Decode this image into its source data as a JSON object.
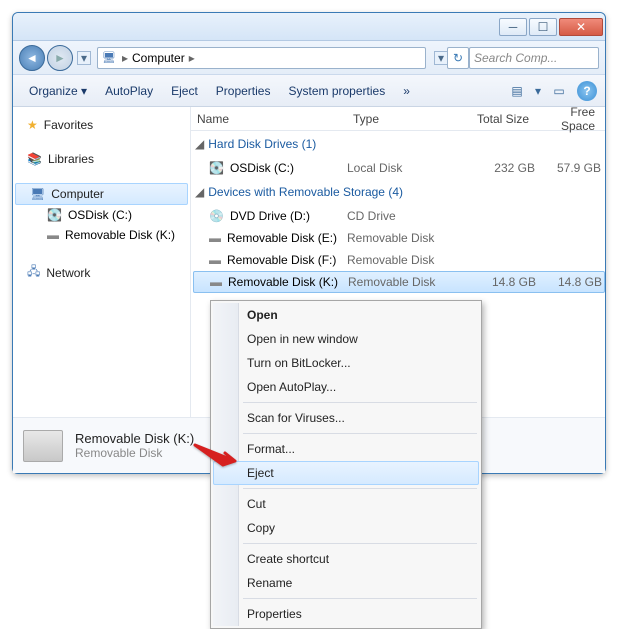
{
  "titlebar": {
    "min": "─",
    "max": "☐",
    "close": "✕"
  },
  "nav": {
    "back": "◄",
    "forward": "►",
    "dropdown": "▾",
    "refresh": "↻"
  },
  "address": {
    "root": "Computer",
    "sep": "▸"
  },
  "search": {
    "placeholder": "Search Comp..."
  },
  "toolbar": {
    "organize": "Organize ▾",
    "autoplay": "AutoPlay",
    "eject": "Eject",
    "properties": "Properties",
    "sysprops": "System properties",
    "overflow": "»",
    "view": "▤",
    "viewdrop": "▾",
    "preview": "▭",
    "help": "?"
  },
  "columns": {
    "name": "Name",
    "type": "Type",
    "size": "Total Size",
    "free": "Free Space"
  },
  "groups": {
    "hdd": {
      "label": "Hard Disk Drives (1)",
      "tri": "◢"
    },
    "rem": {
      "label": "Devices with Removable Storage (4)",
      "tri": "◢"
    }
  },
  "rows": {
    "osdisk": {
      "name": "OSDisk (C:)",
      "type": "Local Disk",
      "size": "232 GB",
      "free": "57.9 GB"
    },
    "dvd": {
      "name": "DVD Drive (D:)",
      "type": "CD Drive",
      "size": "",
      "free": ""
    },
    "remE": {
      "name": "Removable Disk (E:)",
      "type": "Removable Disk",
      "size": "",
      "free": ""
    },
    "remF": {
      "name": "Removable Disk (F:)",
      "type": "Removable Disk",
      "size": "",
      "free": ""
    },
    "remK": {
      "name": "Removable Disk (K:)",
      "type": "Removable Disk",
      "size": "14.8 GB",
      "free": "14.8 GB"
    }
  },
  "sidebar": {
    "favorites": "Favorites",
    "libraries": "Libraries",
    "computer": "Computer",
    "osdisk": "OSDisk (C:)",
    "remk": "Removable Disk (K:)",
    "network": "Network"
  },
  "details": {
    "title": "Removable Disk (K:)",
    "sub": "Removable Disk"
  },
  "context": {
    "open": "Open",
    "opennew": "Open in new window",
    "bitlocker": "Turn on BitLocker...",
    "autoplay": "Open AutoPlay...",
    "scan": "Scan for Viruses...",
    "format": "Format...",
    "eject": "Eject",
    "cut": "Cut",
    "copy": "Copy",
    "shortcut": "Create shortcut",
    "rename": "Rename",
    "properties": "Properties"
  }
}
